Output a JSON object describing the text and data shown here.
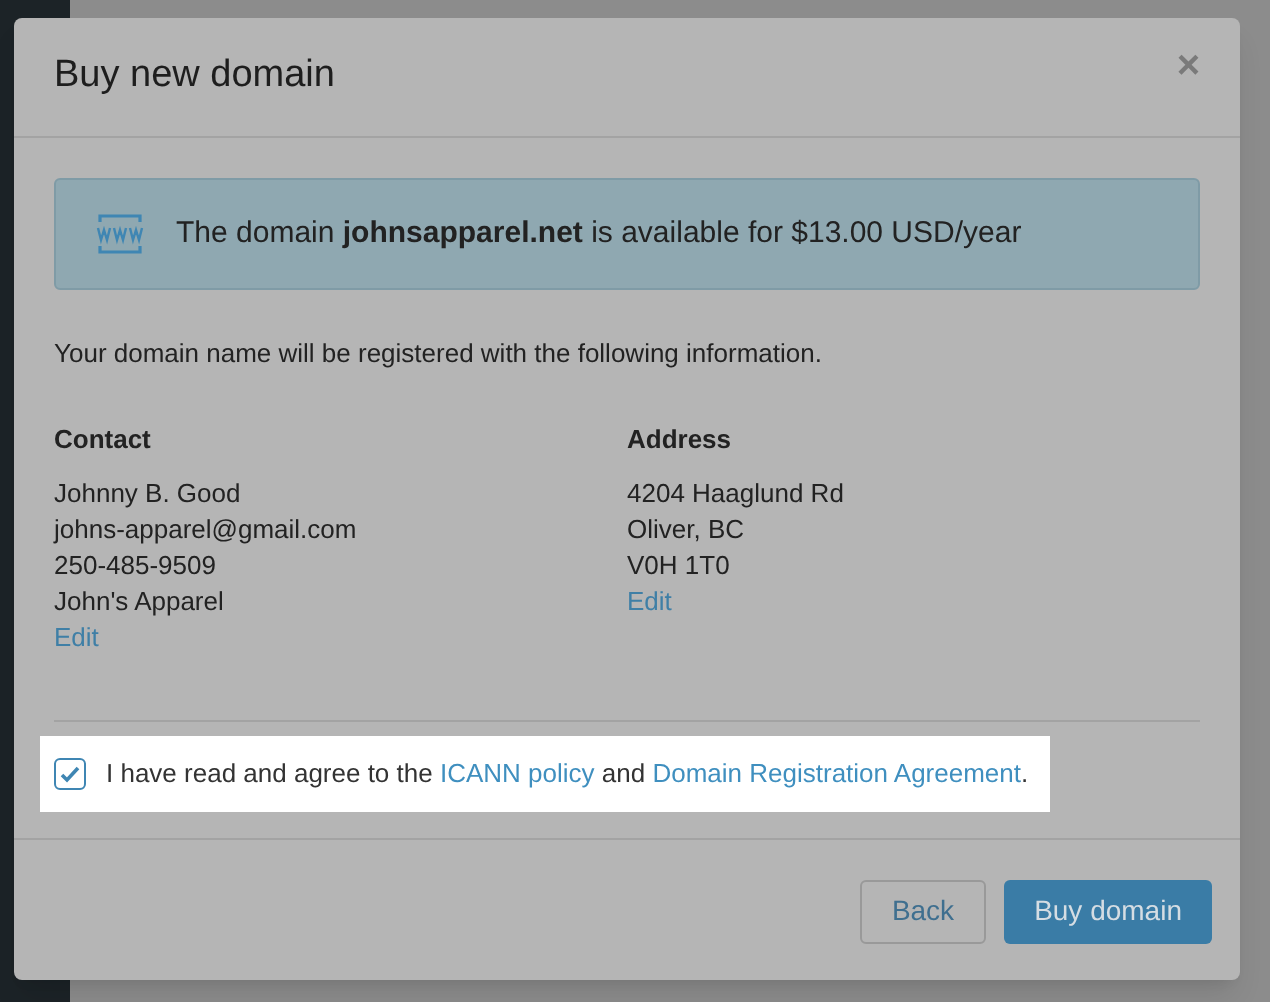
{
  "dialog": {
    "title": "Buy new domain",
    "close": "×"
  },
  "notice": {
    "text": "The domain **johnsapparel.net** is available for $13.00 USD/year"
  },
  "intro": "Your domain name will be registered with the following information.",
  "sections": [
    {
      "heading": "Contact",
      "lines": [
        "Johnny B. Good",
        "johns-apparel@gmail.com",
        "250-485-9509",
        "John's Apparel"
      ],
      "link": "Edit"
    },
    {
      "heading": "Address",
      "lines": [
        "4204 Haaglund Rd",
        "Oliver, BC",
        "V0H 1T0"
      ],
      "link": "Edit"
    }
  ],
  "agreement": {
    "checked": true,
    "before": "I have read and agree to the",
    "link1": "ICANN policy",
    "middle": "and",
    "link2": "Domain Registration Agreement",
    "after": "."
  },
  "buttons": [
    {
      "label": "Back",
      "kind": "secondary"
    },
    {
      "label": "Buy domain",
      "kind": "primary"
    }
  ]
}
